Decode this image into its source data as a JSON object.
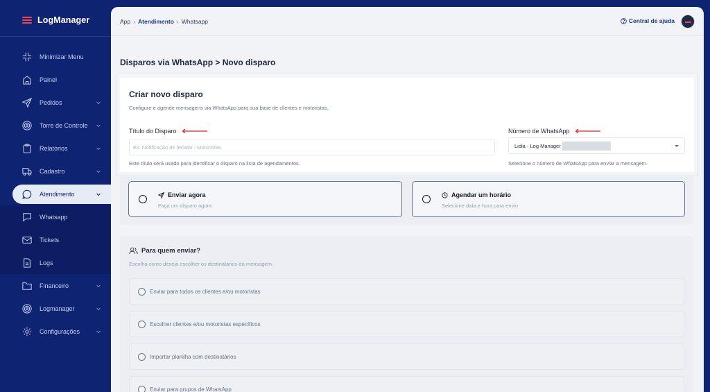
{
  "app": {
    "name": "LogManager"
  },
  "sidebar": {
    "items": [
      {
        "label": "Minimizar Menu",
        "icon": "minimize-icon"
      },
      {
        "label": "Painel",
        "icon": "home-icon"
      },
      {
        "label": "Pedidos",
        "icon": "send-icon"
      },
      {
        "label": "Torre de Controle",
        "icon": "target-icon"
      },
      {
        "label": "Relatórios",
        "icon": "clipboard-icon"
      },
      {
        "label": "Cadastro",
        "icon": "truck-icon"
      },
      {
        "label": "Atendimento",
        "icon": "chat-icon"
      },
      {
        "label": "Whatsapp",
        "icon": "message-square-icon"
      },
      {
        "label": "Tickets",
        "icon": "mail-icon"
      },
      {
        "label": "Logs",
        "icon": "file-icon"
      },
      {
        "label": "Financeiro",
        "icon": "folder-icon"
      },
      {
        "label": "Logmanager",
        "icon": "target-icon"
      },
      {
        "label": "Configurações",
        "icon": "gear-icon"
      }
    ]
  },
  "breadcrumb": {
    "root": "App",
    "middle": "Atendimento",
    "current": "Whatsapp"
  },
  "header": {
    "help": "Central de ajuda"
  },
  "page": {
    "title": "Disparos via WhatsApp > Novo disparo"
  },
  "modal": {
    "title": "Criar novo disparo",
    "description": "Configure e agende mensagens via WhatsApp para sua base de clientes e motoristas.",
    "titulo": {
      "label": "Título do Disparo",
      "placeholder": "Ex: Notificação de feriado - Motoristas",
      "help": "Este título será usado para identificar o disparo na lista de agendamentos."
    },
    "numero": {
      "label": "Número de WhatsApp",
      "value": "Lidia - Log Manager",
      "help": "Selecione o número de WhatsApp para enviar a mensagem."
    }
  },
  "options": [
    {
      "title": "Enviar agora",
      "sub": "Faça um disparo agora",
      "icon": "send-icon"
    },
    {
      "title": "Agendar um horário",
      "sub": "Selecione data e hora para envio",
      "icon": "clock-icon"
    }
  ],
  "recipients": {
    "title": "Para quem enviar?",
    "sub": "Escolha como deseja escolher os destinatários da mensagem.",
    "options": [
      "Enviar para todos os clientes e/ou motoristas",
      "Escolher clientes e/ou motoristas específicos",
      "Importar planilha com destinatários",
      "Enviar para grupos de WhatsApp"
    ]
  },
  "colors": {
    "sidebar": "#0f2373",
    "accent": "#1e3a8a",
    "annotation": "#e02424"
  }
}
